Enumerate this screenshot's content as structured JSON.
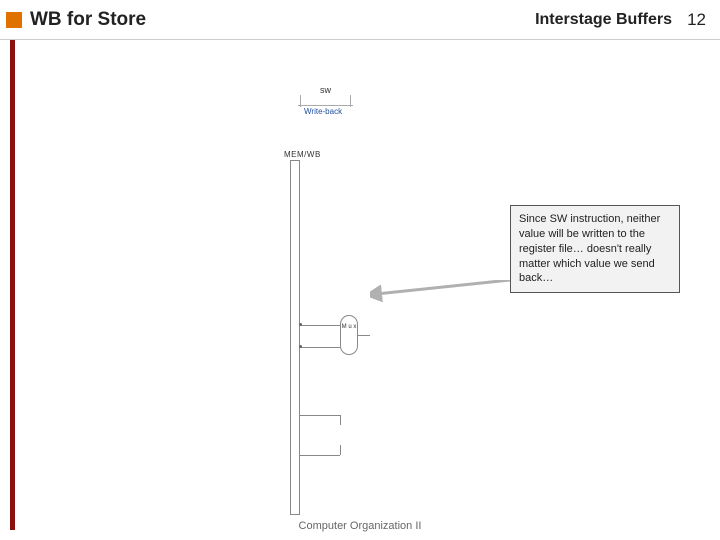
{
  "header": {
    "title": "WB for Store",
    "right_label": "Interstage Buffers",
    "page_number": "12"
  },
  "diagram": {
    "stage_label": "sw",
    "phase_label": "Write-back",
    "buffer_label": "MEM/WB",
    "mux_label": "M\nu\nx"
  },
  "annotation": {
    "text": "Since SW instruction, neither value will be written to the register file… doesn't really matter which value we send back…"
  },
  "footer": {
    "text": "Computer Organization II"
  }
}
